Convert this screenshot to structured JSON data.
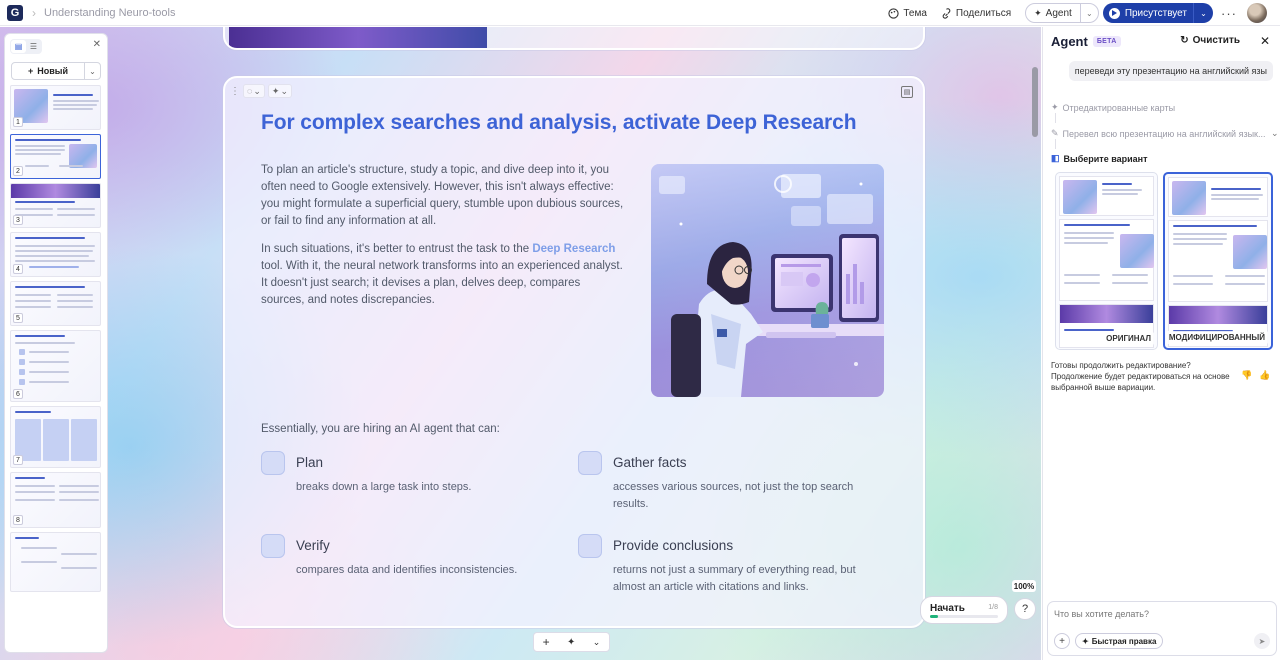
{
  "topbar": {
    "logo": "G",
    "doc_title": "Understanding Neuro-tools",
    "theme_label": "Тема",
    "share_label": "Поделиться",
    "agent_label": "Agent",
    "present_label": "Присутствует",
    "more_label": "···"
  },
  "thumbnails": {
    "new_label": "Новый",
    "items": [
      {
        "num": "1"
      },
      {
        "num": "2"
      },
      {
        "num": "3"
      },
      {
        "num": "4"
      },
      {
        "num": "5"
      },
      {
        "num": "6"
      },
      {
        "num": "7"
      },
      {
        "num": "8"
      }
    ]
  },
  "slide": {
    "title": "For complex searches and analysis, activate Deep Research",
    "para1": "To plan an article's structure, study a topic, and dive deep into it, you often need to Google extensively. However, this isn't always effective: you might formulate a superficial query, stumble upon dubious sources, or fail to find any information at all.",
    "para2_before": "In such situations, it's better to entrust the task to the ",
    "para2_highlight": "Deep Research",
    "para2_after": " tool. With it, the neural network transforms into an experienced analyst. It doesn't just search; it devises a plan, delves deep, compares sources, and notes discrepancies.",
    "hire_intro": "Essentially, you are hiring an AI agent that can:",
    "features": [
      {
        "title": "Plan",
        "desc": "breaks down a large task into steps."
      },
      {
        "title": "Gather facts",
        "desc": "accesses various sources, not just the top search results."
      },
      {
        "title": "Verify",
        "desc": "compares data and identifies inconsistencies."
      },
      {
        "title": "Provide conclusions",
        "desc": "returns not just a summary of everything read, but almost an article with citations and links."
      }
    ]
  },
  "bottom": {
    "zoom": "100%",
    "start_label": "Начать",
    "start_count": "1/8",
    "start_progress": 0.12,
    "help": "?"
  },
  "agent": {
    "title": "Agent",
    "beta": "БЕТА",
    "clear_label": "Очистить",
    "user_message": "переведи эту презентацию на английский язы",
    "steps": [
      {
        "label": "Отредактированные карты"
      },
      {
        "label": "Перевел всю презентацию на английский язык..."
      },
      {
        "label": "Выберите вариант"
      }
    ],
    "variant_original": "ОРИГИНАЛ",
    "variant_modified": "МОДИФИЦИРОВАННЫЙ",
    "message": "Готовы продолжить редактирование? Продолжение будет редактироваться на основе выбранной выше вариации.",
    "composer_placeholder": "Что вы хотите делать?",
    "quick_edit_label": "Быстрая правка"
  }
}
